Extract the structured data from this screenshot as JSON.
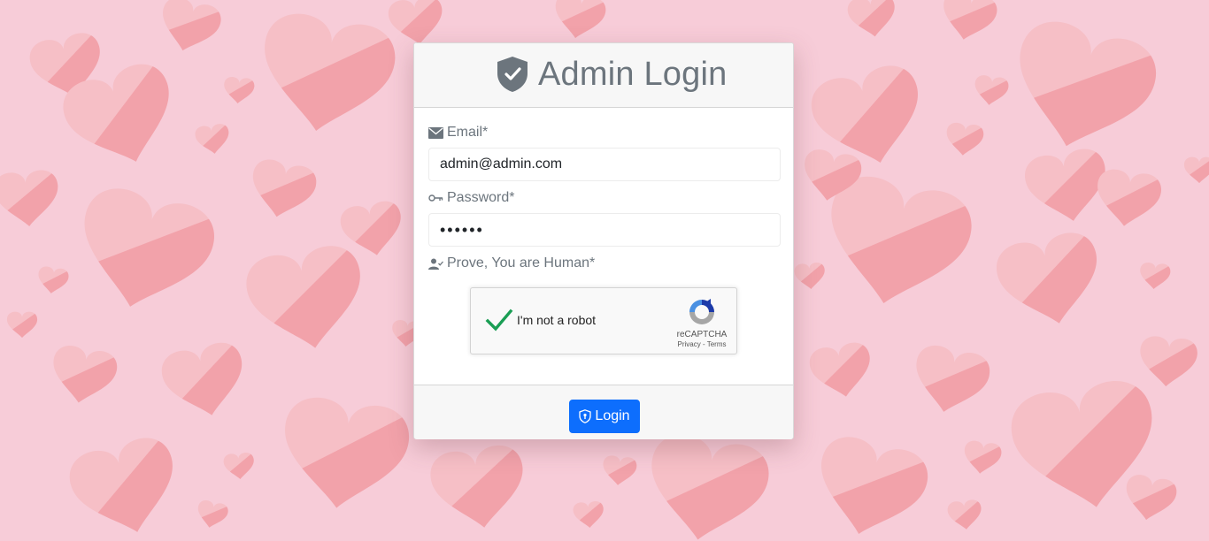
{
  "colors": {
    "background": "#f7ccd8",
    "heart": "#f4a3ab",
    "primary_button": "#0d6efd",
    "muted_text": "#6c757d",
    "recaptcha_check": "#1a9e54"
  },
  "header": {
    "icon": "shield-check-icon",
    "title": "Admin Login"
  },
  "form": {
    "email": {
      "icon": "envelope-icon",
      "label": "Email*",
      "value": "admin@admin.com"
    },
    "password": {
      "icon": "key-icon",
      "label": "Password*",
      "masked_value": "••••••"
    },
    "captcha": {
      "icon": "person-check-icon",
      "label": "Prove, You are Human*",
      "checked": true,
      "checkbox_text": "I'm not a robot",
      "brand": "reCAPTCHA",
      "links": "Privacy - Terms"
    }
  },
  "footer": {
    "login_icon": "shield-lock-icon",
    "login_label": "Login"
  }
}
